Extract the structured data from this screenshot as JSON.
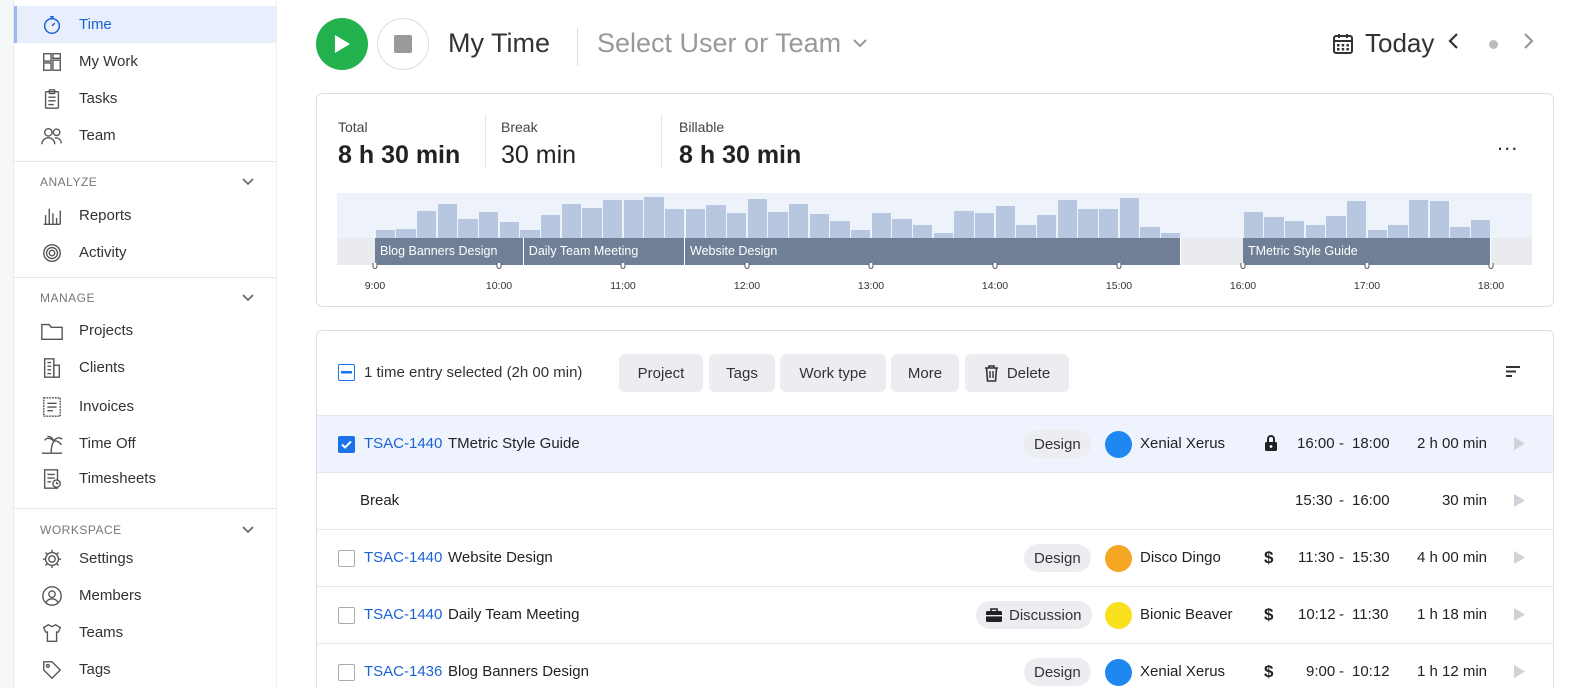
{
  "sidebar": {
    "top_items": [
      {
        "label": "Time",
        "icon": "stopwatch-icon",
        "active": true
      },
      {
        "label": "My Work",
        "icon": "dashboard-icon"
      },
      {
        "label": "Tasks",
        "icon": "clipboard-icon"
      },
      {
        "label": "Team",
        "icon": "people-icon"
      }
    ],
    "analyze": {
      "title": "ANALYZE",
      "items": [
        {
          "label": "Reports",
          "icon": "bar-chart-icon"
        },
        {
          "label": "Activity",
          "icon": "activity-icon"
        }
      ]
    },
    "manage": {
      "title": "MANAGE",
      "items": [
        {
          "label": "Projects",
          "icon": "folder-icon"
        },
        {
          "label": "Clients",
          "icon": "building-icon"
        },
        {
          "label": "Invoices",
          "icon": "invoice-icon"
        },
        {
          "label": "Time Off",
          "icon": "palm-tree-icon"
        },
        {
          "label": "Timesheets",
          "icon": "timesheet-icon"
        }
      ]
    },
    "workspace": {
      "title": "WORKSPACE",
      "items": [
        {
          "label": "Settings",
          "icon": "gear-icon"
        },
        {
          "label": "Members",
          "icon": "user-circle-icon"
        },
        {
          "label": "Teams",
          "icon": "teams-icon"
        },
        {
          "label": "Tags",
          "icon": "tag-icon"
        }
      ]
    }
  },
  "header": {
    "title": "My Time",
    "user_select": "Select User or Team",
    "date_label": "Today"
  },
  "summary": {
    "total_label": "Total",
    "total_value": "8 h 30 min",
    "break_label": "Break",
    "break_value": "30 min",
    "billable_label": "Billable",
    "billable_value": "8 h 30 min",
    "more": "..."
  },
  "timeline": {
    "ticks": [
      "9:00",
      "10:00",
      "11:00",
      "12:00",
      "13:00",
      "14:00",
      "15:00",
      "16:00",
      "17:00",
      "18:00"
    ],
    "segments": [
      {
        "label": "Blog Banners Design",
        "start": 9.0,
        "end": 10.2
      },
      {
        "label": "Daily Team Meeting",
        "start": 10.2,
        "end": 11.5
      },
      {
        "label": "Website Design",
        "start": 11.5,
        "end": 15.5
      },
      {
        "label": "TMetric Style Guide",
        "start": 16.0,
        "end": 18.0
      }
    ],
    "activity": [
      0.2,
      0.22,
      0.65,
      0.8,
      0.45,
      0.62,
      0.38,
      0.2,
      0.55,
      0.8,
      0.72,
      0.9,
      0.9,
      0.98,
      0.7,
      0.68,
      0.78,
      0.6,
      0.92,
      0.62,
      0.82,
      0.58,
      0.4,
      0.18,
      0.6,
      0.45,
      0.3,
      0.12,
      0.65,
      0.6,
      0.75,
      0.32,
      0.55,
      0.9,
      0.7,
      0.68,
      0.95,
      0.25,
      0.12,
      0,
      0,
      0,
      0.62,
      0.5,
      0.4,
      0.3,
      0.52,
      0.88,
      0.2,
      0.3,
      0.9,
      0.88,
      0.25,
      0.42
    ]
  },
  "toolbar": {
    "selected_text": "1 time entry selected (2h 00 min)",
    "project": "Project",
    "tags": "Tags",
    "work_type": "Work type",
    "more": "More",
    "delete": "Delete"
  },
  "entries": [
    {
      "id": "TSAC-1440",
      "desc": "TMetric Style Guide",
      "tag": "Design",
      "project": "Xenial Xerus",
      "color": "#1e88f0",
      "billing": "lock",
      "start": "16:00",
      "end": "18:00",
      "duration": "2 h 00 min",
      "checked": true
    },
    {
      "id": "",
      "desc": "Break",
      "tag": "",
      "project": "",
      "color": "",
      "billing": "",
      "start": "15:30",
      "end": "16:00",
      "duration": "30 min",
      "checked": false,
      "is_break": true
    },
    {
      "id": "TSAC-1440",
      "desc": "Website Design",
      "tag": "Design",
      "project": "Disco Dingo",
      "color": "#f5a623",
      "billing": "$",
      "start": "11:30",
      "end": "15:30",
      "duration": "4 h 00 min",
      "checked": false
    },
    {
      "id": "TSAC-1440",
      "desc": "Daily Team Meeting",
      "tag": "Discussion",
      "tag_icon": "briefcase-icon",
      "project": "Bionic Beaver",
      "color": "#f8e01d",
      "billing": "$",
      "start": "10:12",
      "end": "11:30",
      "duration": "1 h 18 min",
      "checked": false
    },
    {
      "id": "TSAC-1436",
      "desc": "Blog Banners Design",
      "tag": "Design",
      "project": "Xenial Xerus",
      "color": "#1e88f0",
      "billing": "$",
      "start": "9:00",
      "end": "10:12",
      "duration": "1 h 12 min",
      "checked": false
    }
  ]
}
